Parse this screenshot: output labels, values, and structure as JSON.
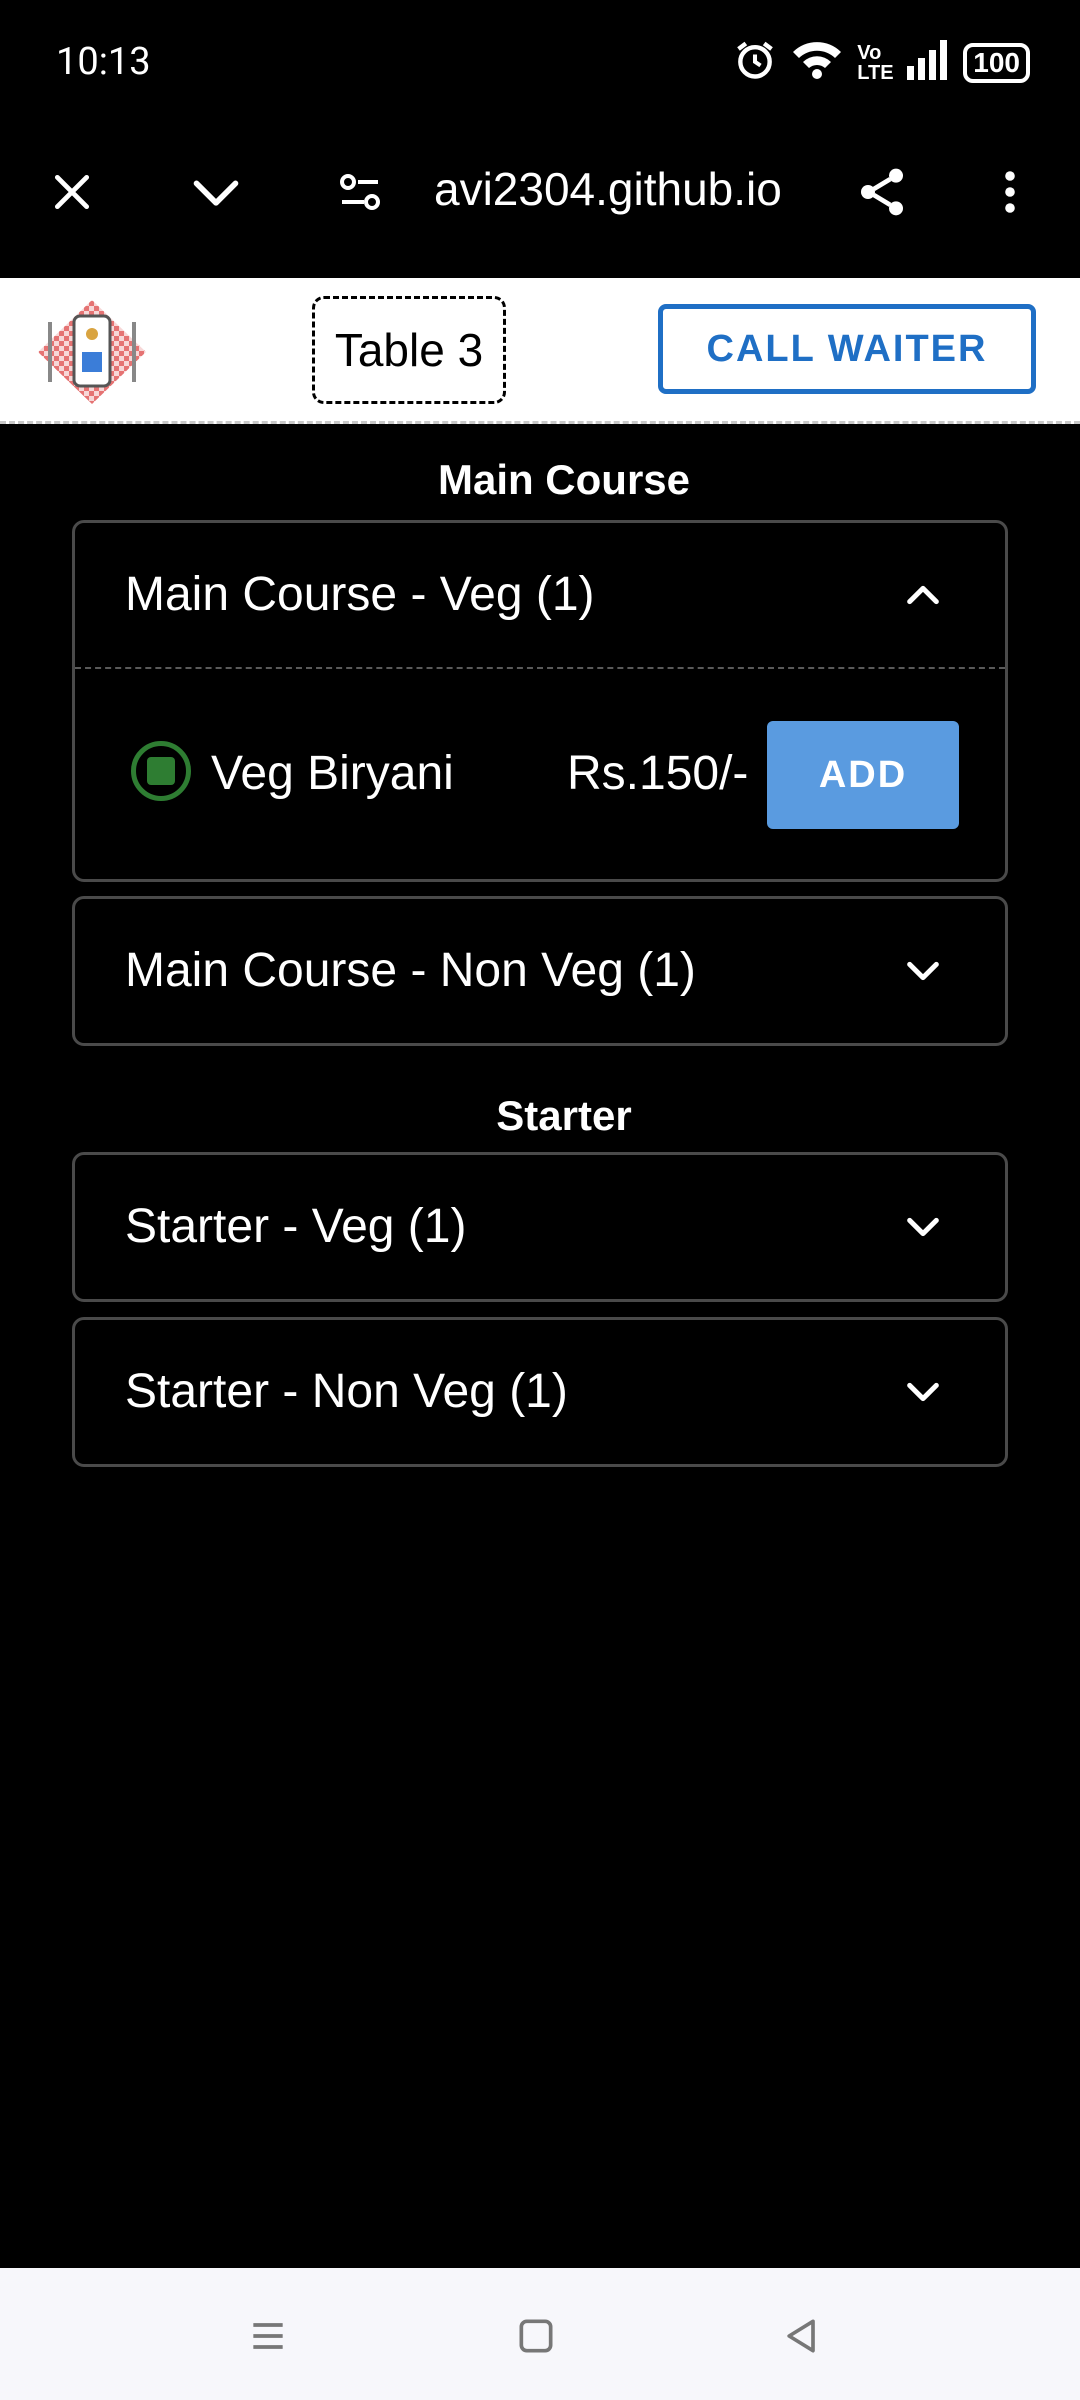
{
  "status_bar": {
    "time": "10:13",
    "network": "Vo LTE",
    "battery": "100"
  },
  "browser": {
    "url": "avi2304.github.io"
  },
  "header": {
    "table_label": "Table 3",
    "call_waiter_label": "CALL WAITER"
  },
  "sections": [
    {
      "title": "Main Course",
      "groups": [
        {
          "title": "Main Course - Veg (1)",
          "expanded": true,
          "items": [
            {
              "name": "Veg Biryani",
              "price": "Rs.150/-",
              "add_label": "ADD"
            }
          ]
        },
        {
          "title": "Main Course - Non Veg (1)",
          "expanded": false
        }
      ]
    },
    {
      "title": "Starter",
      "groups": [
        {
          "title": "Starter - Veg (1)",
          "expanded": false
        },
        {
          "title": "Starter - Non Veg (1)",
          "expanded": false
        }
      ]
    }
  ],
  "colors": {
    "accent": "#1f6fc5",
    "add_button": "#5a9be0",
    "veg_green": "#2e7d32"
  }
}
